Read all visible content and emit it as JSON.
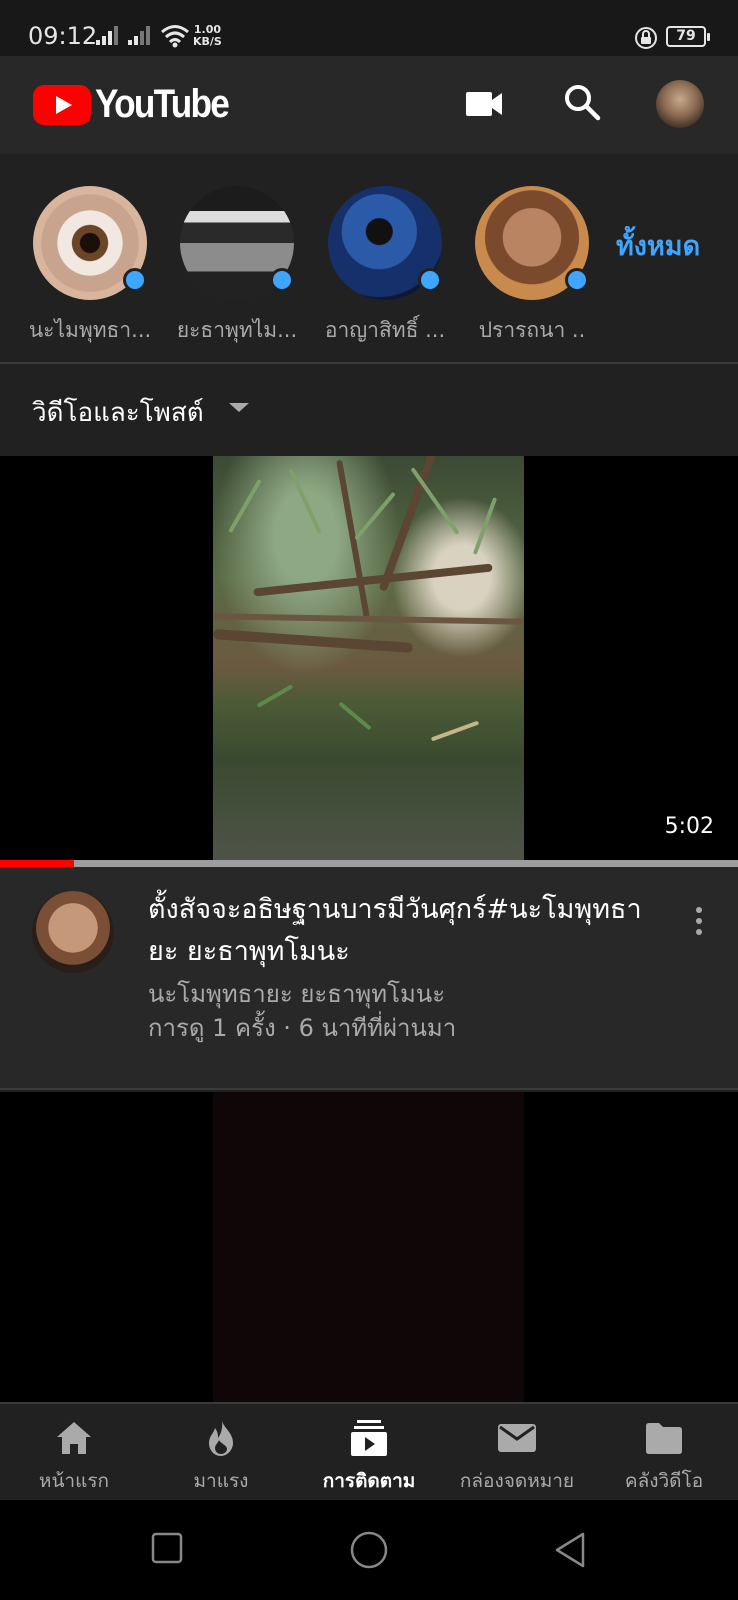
{
  "status_bar": {
    "time": "09:12",
    "net_speed_value": "1.00",
    "net_speed_unit": "KB/S",
    "battery": "79",
    "icons": [
      "signal-icon",
      "signal-icon",
      "wifi-icon",
      "rotation-lock-icon",
      "battery-icon"
    ]
  },
  "app_bar": {
    "logo_text": "YouTube",
    "icons": [
      "camera-icon",
      "search-icon",
      "account-avatar"
    ]
  },
  "subscriptions": {
    "channels": [
      {
        "name": "นะไมพุทธา..."
      },
      {
        "name": "ยะธาพุทไม..."
      },
      {
        "name": "อาญาสิทธิ์ ..."
      },
      {
        "name": "ปรารถนา .."
      }
    ],
    "see_all_label": "ทั้งหมด"
  },
  "filter": {
    "label": "วิดีโอและโพสต์"
  },
  "video": {
    "duration": "5:02",
    "watched_fraction": 0.1,
    "title": "ตั้งสัจจะอธิษฐานบารมีวันศุกร์#นะโมพุทธายะ ยะธาพุทโมนะ",
    "channel": "นะโมพุทธายะ ยะธาพุทโมนะ",
    "stats": "การดู 1 ครั้ง · 6 นาทีที่ผ่านมา"
  },
  "bottom_nav": {
    "items": [
      {
        "label": "หน้าแรก",
        "icon": "home-icon"
      },
      {
        "label": "มาแรง",
        "icon": "trending-icon"
      },
      {
        "label": "การติดตาม",
        "icon": "subscriptions-icon",
        "active": true
      },
      {
        "label": "กล่องจดหมาย",
        "icon": "inbox-icon"
      },
      {
        "label": "คลังวิดีโอ",
        "icon": "library-icon"
      }
    ]
  },
  "colors": {
    "brand_red": "#ff0000",
    "accent_blue": "#3ea6ff",
    "background": "#212121"
  }
}
